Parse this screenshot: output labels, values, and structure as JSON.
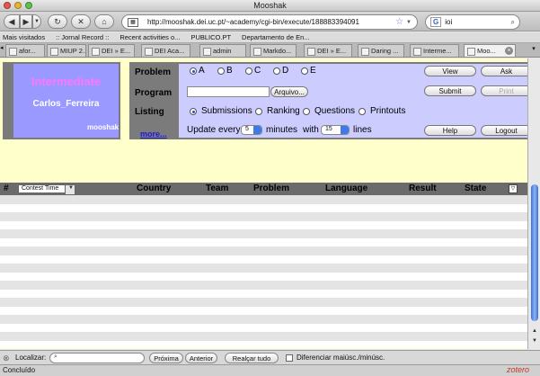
{
  "window": {
    "title": "Mooshak"
  },
  "nav": {
    "url": "http://mooshak.dei.uc.pt/~academy/cgi-bin/execute/188883394091",
    "search_engine": "G",
    "search_value": "ioi"
  },
  "bookmarks": [
    "Mais visitados",
    ":: Jornal Record ::",
    "Recent activities o...",
    "PUBLICO.PT",
    "Departamento de En..."
  ],
  "tabs": [
    "afor...",
    "MIUP 2...",
    "DEI » E...",
    "DEI Aca...",
    "admin",
    "Markdo...",
    "DEI » E...",
    "Daring ...",
    "Interme...",
    "Moo..."
  ],
  "info": {
    "level": "Intermediate",
    "user": "Carlos_Ferreira",
    "logo": "mooshak"
  },
  "controls": {
    "problem_label": "Problem",
    "program_label": "Program",
    "listing_label": "Listing",
    "more_label": "more...",
    "problems": [
      "A",
      "B",
      "C",
      "D",
      "E"
    ],
    "selected_problem": "A",
    "file_button": "Arquivo...",
    "listings": [
      "Submissions",
      "Ranking",
      "Questions",
      "Printouts"
    ],
    "selected_listing": "Submissions",
    "update_prefix": "Update every",
    "update_minutes": "5",
    "minutes_label": "minutes",
    "with_label": "with",
    "lines_value": "15",
    "lines_label": "lines",
    "buttons": {
      "view": "View",
      "ask": "Ask",
      "submit": "Submit",
      "print": "Print",
      "help": "Help",
      "logout": "Logout"
    }
  },
  "table": {
    "columns": {
      "num": "#",
      "time": "Contest Time",
      "country": "Country",
      "team": "Team",
      "problem": "Problem",
      "language": "Language",
      "result": "Result",
      "state": "State"
    }
  },
  "findbar": {
    "label": "Localizar:",
    "next": "Próxima",
    "previous": "Anterior",
    "highlight": "Realçar tudo",
    "match_case": "Diferenciar maiúsc./minúsc."
  },
  "status": {
    "text": "Concluído",
    "zotero": "zotero"
  },
  "colors": {
    "info_bg": "#9999ff",
    "ctrl_bg": "#ccccff",
    "page_bg": "#ffffcc",
    "level_color": "#ff77ff",
    "header_bg": "#6b6b6b"
  }
}
